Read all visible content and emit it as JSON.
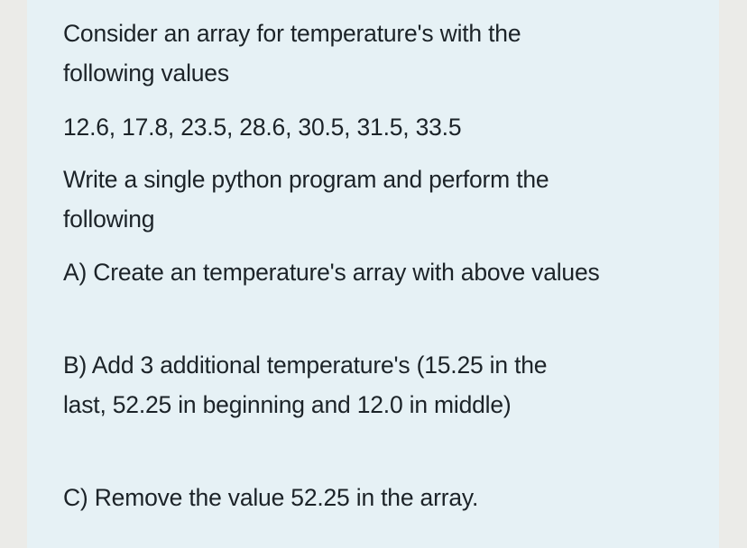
{
  "question": {
    "intro_line1": "Consider an array for temperature's with the",
    "intro_line2": "following values",
    "values_line": "12.6, 17.8, 23.5, 28.6, 30.5, 31.5, 33.5",
    "values": [
      12.6,
      17.8,
      23.5,
      28.6,
      30.5,
      31.5,
      33.5
    ],
    "task_line1": "Write a single python program and perform the",
    "task_line2": "following",
    "part_a": "A) Create an temperature's array with above values",
    "part_b_line1": "B) Add 3 additional temperature's (15.25 in the",
    "part_b_line2": "last, 52.25 in beginning and 12.0 in middle)",
    "part_c": "C) Remove the value 52.25 in the array."
  }
}
